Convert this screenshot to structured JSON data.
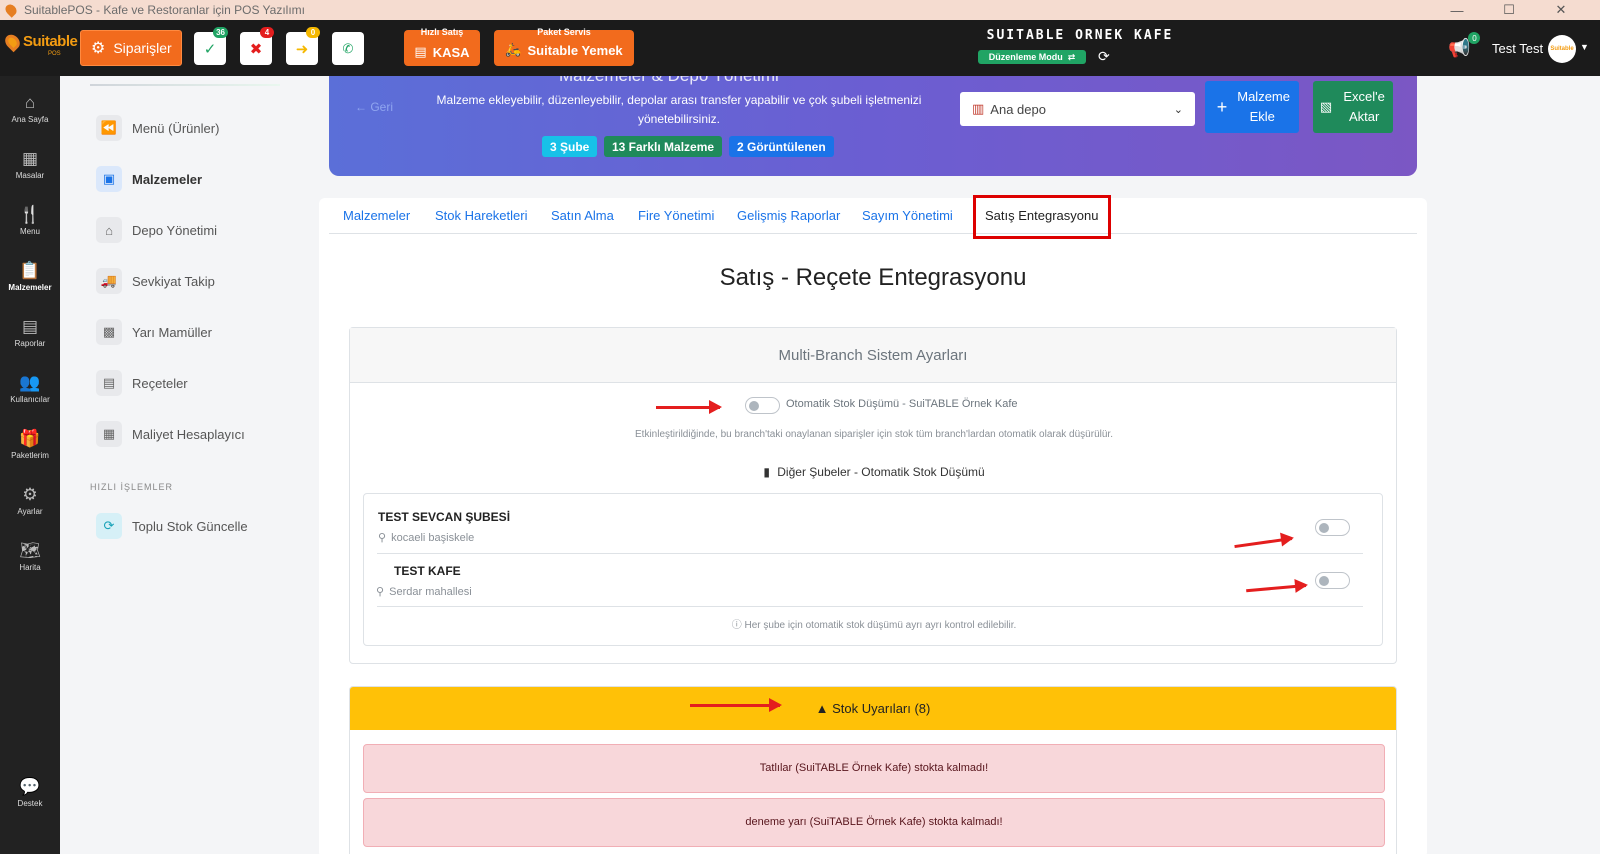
{
  "window": {
    "title": "SuitablePOS - Kafe ve Restoranlar için POS Yazılımı",
    "minimize": "—",
    "maximize": "☐",
    "close": "✕"
  },
  "topbar": {
    "logo": "Suitable",
    "logo_sub": "POS",
    "orders_label": "Siparişler",
    "badges": {
      "approved": "36",
      "rejected": "4",
      "forwarded": "0"
    },
    "quick_sale_caption": "Hızlı Satış",
    "kasa_label": "KASA",
    "package_caption": "Paket Servis",
    "yemek_label": "Suitable Yemek",
    "cafe_name": "SUITABLE ORNEK KAFE",
    "mode_label": "Düzenleme Modu",
    "notif_count": "0",
    "user_name": "Test Test",
    "avatar_text": "Suitable"
  },
  "leftnav": [
    {
      "label": "Ana Sayfa",
      "icon": "home-icon"
    },
    {
      "label": "Masalar",
      "icon": "table-icon"
    },
    {
      "label": "Menu",
      "icon": "utensils-icon"
    },
    {
      "label": "Malzemeler",
      "icon": "clipboard-icon"
    },
    {
      "label": "Raporlar",
      "icon": "report-icon"
    },
    {
      "label": "Kullanıcılar",
      "icon": "users-icon"
    },
    {
      "label": "Paketlerim",
      "icon": "gift-icon"
    },
    {
      "label": "Ayarlar",
      "icon": "gears-icon"
    },
    {
      "label": "Harita",
      "icon": "map-icon"
    },
    {
      "label": "Destek",
      "icon": "chat-icon"
    }
  ],
  "subnav": {
    "items": [
      {
        "label": "Menü (Ürünler)",
        "icon": "backward-icon"
      },
      {
        "label": "Malzemeler",
        "icon": "box-icon"
      },
      {
        "label": "Depo Yönetimi",
        "icon": "warehouse-icon"
      },
      {
        "label": "Sevkiyat Takip",
        "icon": "truck-icon"
      },
      {
        "label": "Yarı Mamüller",
        "icon": "boxes-icon"
      },
      {
        "label": "Reçeteler",
        "icon": "recipe-icon"
      },
      {
        "label": "Maliyet Hesaplayıcı",
        "icon": "calculator-icon"
      }
    ],
    "section_label": "HIZLI İŞLEMLER",
    "quick_item": {
      "label": "Toplu Stok Güncelle",
      "icon": "sync-icon"
    }
  },
  "hero": {
    "cut_title": "Malzemeler & Depo Yönetimi",
    "back": "Geri",
    "description": "Malzeme ekleyebilir, düzenleyebilir, depolar arası transfer yapabilir ve çok şubeli işletmenizi yönetebilirsiniz.",
    "pills": [
      "3 Şube",
      "13 Farklı Malzeme",
      "2 Görüntülenen"
    ],
    "depot": "Ana depo",
    "add_btn": "Malzeme Ekle",
    "excel_btn": "Excel'e Aktar"
  },
  "tabs": [
    "Malzemeler",
    "Stok Hareketleri",
    "Satın Alma",
    "Fire Yönetimi",
    "Gelişmiş Raporlar",
    "Sayım Yönetimi",
    "Satış Entegrasyonu"
  ],
  "page_title": "Satış - Reçete Entegrasyonu",
  "multi_branch": {
    "header": "Multi-Branch Sistem Ayarları",
    "auto_label": "Otomatik Stok Düşümü - SuiTABLE Örnek Kafe",
    "auto_help": "Etkinleştirildiğinde, bu branch'taki onaylanan siparişler için stok tüm branch'lardan otomatik olarak düşürülür.",
    "other_branches_title": "Diğer Şubeler - Otomatik Stok Düşümü",
    "branches": [
      {
        "name": "TEST SEVCAN ŞUBESİ",
        "location": "kocaeli başiskele",
        "enabled": false
      },
      {
        "name": "TEST KAFE",
        "location": "Serdar mahallesi",
        "enabled": false
      }
    ],
    "note": "Her şube için otomatik stok düşümü ayrı ayrı kontrol edilebilir."
  },
  "stock_warnings": {
    "header": "Stok Uyarıları (8)",
    "alerts": [
      "Tatlılar (SuiTABLE Örnek Kafe) stokta kalmadı!",
      "deneme yarı (SuiTABLE Örnek Kafe) stokta kalmadı!"
    ]
  }
}
